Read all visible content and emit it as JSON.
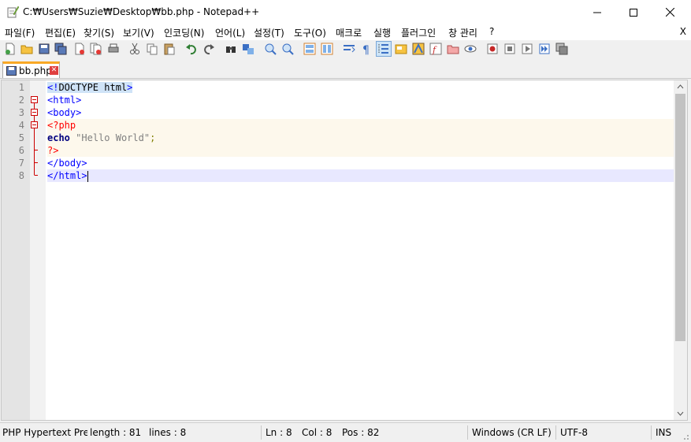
{
  "window": {
    "title": "C:₩Users₩Suzie₩Desktop₩bb.php - Notepad++"
  },
  "menu": {
    "items": [
      "파일(F)",
      "편집(E)",
      "찾기(S)",
      "보기(V)",
      "인코딩(N)",
      "언어(L)",
      "설정(T)",
      "도구(O)",
      "매크로",
      "실행",
      "플러그인",
      "창 관리",
      "?"
    ],
    "close": "X"
  },
  "tab": {
    "label": "bb.php"
  },
  "editor": {
    "line_numbers": [
      "1",
      "2",
      "3",
      "4",
      "5",
      "6",
      "7",
      "8"
    ],
    "lines": [
      [
        {
          "t": "<!",
          "c": "#0000ff",
          "bg": "#cfe3f7"
        },
        {
          "t": "DOCTYPE html",
          "c": "#000000",
          "bg": "#cfe3f7"
        },
        {
          "t": ">",
          "c": "#0000ff",
          "bg": "#cfe3f7"
        }
      ],
      [
        {
          "t": "<html>",
          "c": "#0000ff"
        }
      ],
      [
        {
          "t": "<body>",
          "c": "#0000ff"
        }
      ],
      [
        {
          "t": "<?php",
          "c": "#ff0000"
        }
      ],
      [
        {
          "t": "echo",
          "c": "#000080",
          "b": true
        },
        {
          "t": " ",
          "c": "#000000"
        },
        {
          "t": "\"Hello World\"",
          "c": "#808080"
        },
        {
          "t": ";",
          "c": "#808000"
        }
      ],
      [
        {
          "t": "?>",
          "c": "#ff0000"
        }
      ],
      [
        {
          "t": "</body>",
          "c": "#0000ff"
        }
      ],
      [
        {
          "t": "</html>",
          "c": "#0000ff"
        }
      ]
    ]
  },
  "status": {
    "language": "PHP Hypertext Prep",
    "length": "length : 81",
    "lines": "lines : 8",
    "ln": "Ln : 8",
    "col": "Col : 8",
    "pos": "Pos : 82",
    "eol": "Windows (CR LF)",
    "encoding": "UTF-8",
    "mode": "INS"
  }
}
